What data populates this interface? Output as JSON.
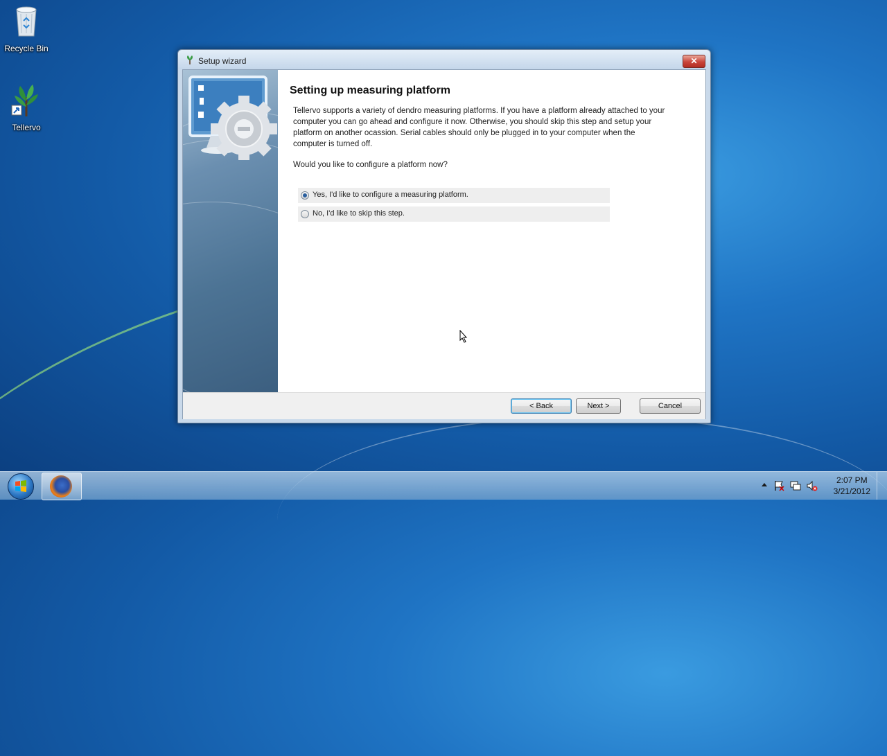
{
  "desktop": {
    "icons": [
      {
        "label": "Recycle Bin",
        "icon": "recycle-bin-icon"
      },
      {
        "label": "Tellervo",
        "icon": "tellervo-tree-icon"
      }
    ]
  },
  "window": {
    "title": "Setup wizard",
    "close_label": "✕",
    "heading": "Setting up measuring platform",
    "description": "Tellervo supports a variety of dendro measuring platforms. If you have a platform already attached to your\ncomputer you can go ahead and configure it now.  Otherwise, you should skip this step and setup your\nplatform on another ocassion.  Serial cables should only be plugged in to your computer when the\ncomputer is turned off.",
    "question": "Would you like to configure a platform now?",
    "options": [
      {
        "label": "Yes, I'd like to configure a measuring platform.",
        "selected": true
      },
      {
        "label": "No, I'd like to skip this step.",
        "selected": false
      }
    ],
    "buttons": {
      "back": "< Back",
      "next": "Next >",
      "cancel": "Cancel"
    }
  },
  "taskbar": {
    "tray_icons": [
      "show-hidden-icons-arrow",
      "action-center-flag-icon",
      "network-icon",
      "volume-muted-icon"
    ],
    "time": "2:07 PM",
    "date": "3/21/2012"
  }
}
